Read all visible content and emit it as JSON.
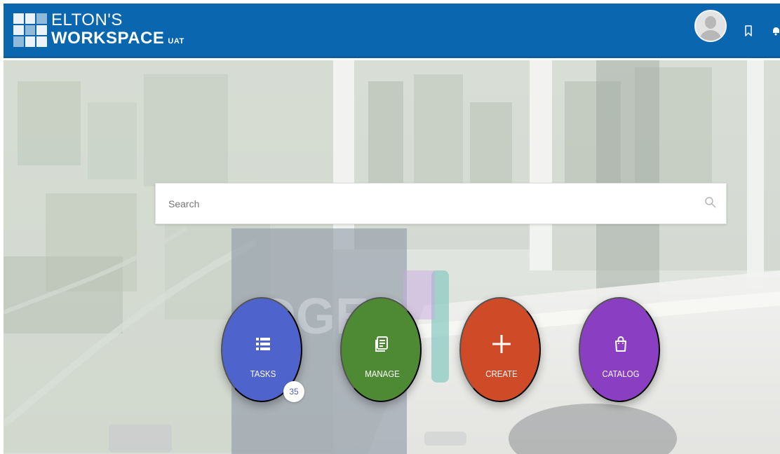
{
  "header": {
    "brand_line1": "ELTON'S",
    "brand_line2": "WORKSPACE",
    "environment": "UAT",
    "icons": [
      "avatar",
      "bookmark-icon",
      "edge-icon"
    ]
  },
  "search": {
    "placeholder": "Search",
    "value": "",
    "icon": "search-icon"
  },
  "tiles": [
    {
      "label": "TASKS",
      "icon": "list-icon",
      "color": "#4f63cc",
      "badge": "35"
    },
    {
      "label": "MANAGE",
      "icon": "document-copy-icon",
      "color": "#4e8a33"
    },
    {
      "label": "CREATE",
      "icon": "plus-icon",
      "color": "#cf4a26"
    },
    {
      "label": "CATALOG",
      "icon": "shopping-bag-icon",
      "color": "#8a3fc2"
    }
  ],
  "colors": {
    "header_bg": "#0a66ae",
    "search_bg": "#ffffff"
  }
}
